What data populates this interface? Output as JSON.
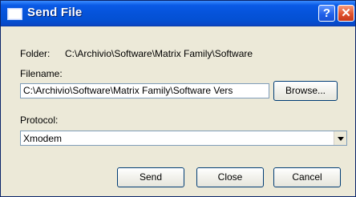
{
  "window": {
    "title": "Send File",
    "help_label": "?",
    "close_label": "✕"
  },
  "folder": {
    "label": "Folder:",
    "value": "C:\\Archivio\\Software\\Matrix Family\\Software"
  },
  "filename": {
    "label": "Filename:",
    "value": "C:\\Archivio\\Software\\Matrix Family\\Software Vers",
    "browse_label": "Browse..."
  },
  "protocol": {
    "label": "Protocol:",
    "selected": "Xmodem"
  },
  "buttons": {
    "send": "Send",
    "close": "Close",
    "cancel": "Cancel"
  },
  "colors": {
    "titlebar": "#0553da",
    "dialog_background": "#ece9d8",
    "close_button": "#e0512c"
  }
}
